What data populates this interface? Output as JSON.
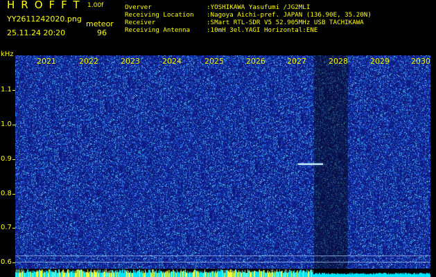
{
  "header": {
    "app_title": "HROFFT",
    "version": "1.00f",
    "filename": "YY2611242020.png",
    "datetime": "25.11.24 20:20",
    "event_label": "meteor",
    "event_count": "96",
    "info": [
      {
        "key": "Overver",
        "value": ":YOSHIKAWA Yasufumi /JG2MLI"
      },
      {
        "key": "Receiving Location",
        "value": ":Nagoya Aichi-pref. JAPAN (136.90E, 35.20N)"
      },
      {
        "key": "Receiver",
        "value": ":SMart RTL-SDR V5 52.905MHz USB TACHIKAWA"
      },
      {
        "key": "Receiving Antenna",
        "value": ":10mH 3el.YAGI Horizontal:ENE"
      }
    ]
  },
  "axis": {
    "unit": "kHz",
    "yticks": [
      "1.1",
      "1.0",
      "0.9",
      "0.8",
      "0.7",
      "0.6"
    ],
    "xticks": [
      "2021",
      "2022",
      "2023",
      "2024",
      "2025",
      "2026",
      "2027",
      "2028",
      "2029",
      "2030"
    ]
  },
  "colors": {
    "text": "#ffff00",
    "background": "#000000",
    "spectrum_base": "#1a2a9a",
    "strip": "#00e5ff"
  }
}
